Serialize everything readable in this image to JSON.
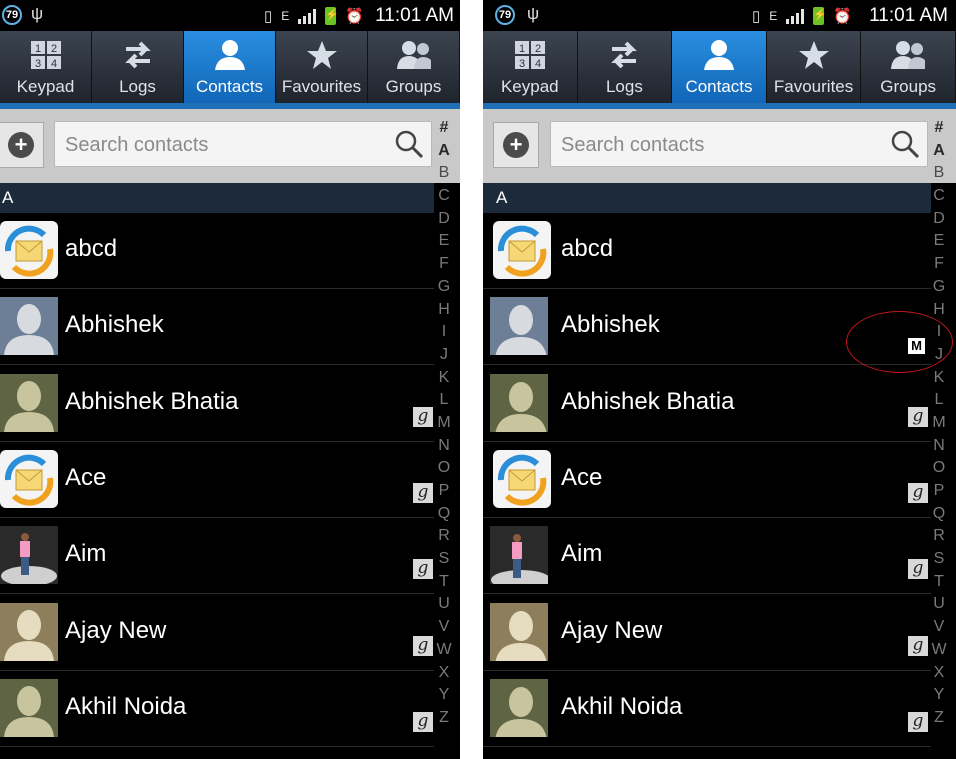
{
  "status": {
    "badge": "79",
    "time": "11:01 AM",
    "network": "E"
  },
  "tabs": [
    {
      "label": "Keypad",
      "icon": "keypad-icon"
    },
    {
      "label": "Logs",
      "icon": "logs-icon"
    },
    {
      "label": "Contacts",
      "icon": "contacts-icon",
      "active": true
    },
    {
      "label": "Favourites",
      "icon": "star-icon"
    },
    {
      "label": "Groups",
      "icon": "groups-icon"
    }
  ],
  "search": {
    "placeholder": "Search contacts"
  },
  "section": "A",
  "contacts": [
    {
      "name": "abcd",
      "avatar": "sync-email-avatar",
      "google": false
    },
    {
      "name": "Abhishek",
      "avatar": "default-blue-avatar",
      "google": false
    },
    {
      "name": "Abhishek Bhatia",
      "avatar": "default-olive-avatar",
      "google": true
    },
    {
      "name": "Ace",
      "avatar": "sync-email-avatar",
      "google": true
    },
    {
      "name": "Aim",
      "avatar": "photo-avatar",
      "google": true
    },
    {
      "name": "Ajay New",
      "avatar": "default-tan-avatar",
      "google": true
    },
    {
      "name": "Akhil Noida",
      "avatar": "default-olive-avatar",
      "google": true
    }
  ],
  "google_badge": "g",
  "index": [
    "#",
    "A",
    "B",
    "C",
    "D",
    "E",
    "F",
    "G",
    "H",
    "I",
    "J",
    "K",
    "L",
    "M",
    "N",
    "O",
    "P",
    "Q",
    "R",
    "S",
    "T",
    "U",
    "V",
    "W",
    "X",
    "Y",
    "Z"
  ],
  "popup_letter": "M",
  "annotation_color": "#c0161d"
}
